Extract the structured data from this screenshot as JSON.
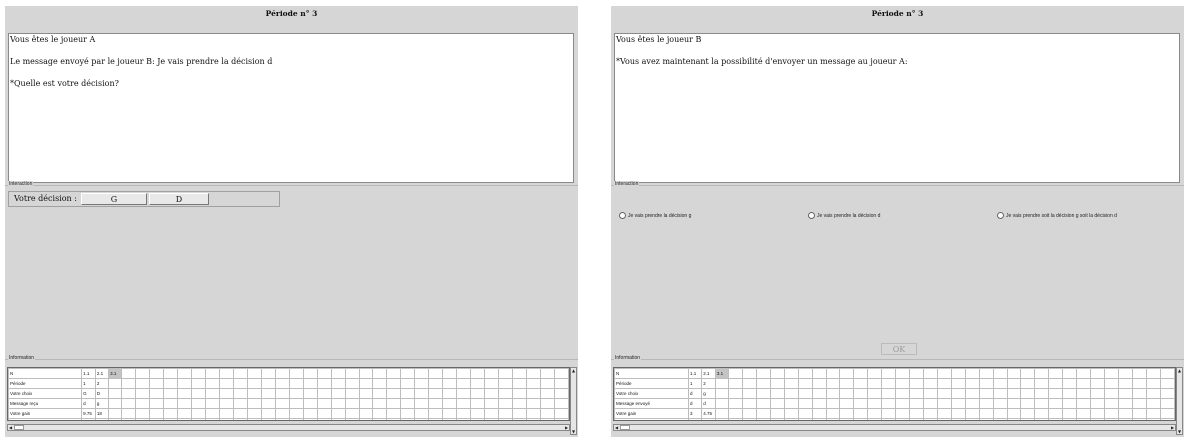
{
  "left": {
    "title": "Période n° 3",
    "messages": [
      "Vous êtes le joueur A",
      "Le message envoyé par le joueur B: Je vais prendre la décision d",
      "*Quelle est votre décision?"
    ],
    "interaction_label": "Interaction",
    "decision_label": "Votre décision :",
    "btn_g": "G",
    "btn_d": "D",
    "information_label": "Information",
    "table": {
      "header": [
        "N",
        "1.1",
        "2.1",
        "3.1"
      ],
      "rows": [
        [
          "Période",
          "1",
          "2"
        ],
        [
          "Votre choix",
          "G",
          "D"
        ],
        [
          "Message reçu",
          "d",
          "g"
        ],
        [
          "Votre gain",
          "9.75",
          "18"
        ]
      ]
    }
  },
  "right": {
    "title": "Période n° 3",
    "messages": [
      "Vous êtes le joueur B",
      "*Vous avez maintenant la possibilité d'envoyer un message au joueur A:"
    ],
    "interaction_label": "Interaction",
    "options": [
      "Je vais prendre la décision g",
      "Je vais prendre la décision d",
      "Je vais prendre soit la décision g soit la décision d"
    ],
    "ok_label": "OK",
    "information_label": "Information",
    "table": {
      "header": [
        "N",
        "1.1",
        "2.1",
        "3.1"
      ],
      "rows": [
        [
          "Période",
          "1",
          "2"
        ],
        [
          "Votre choix",
          "d",
          "g"
        ],
        [
          "Message envoyé",
          "d",
          "d"
        ],
        [
          "Votre gain",
          "3",
          "4.75"
        ]
      ]
    }
  }
}
